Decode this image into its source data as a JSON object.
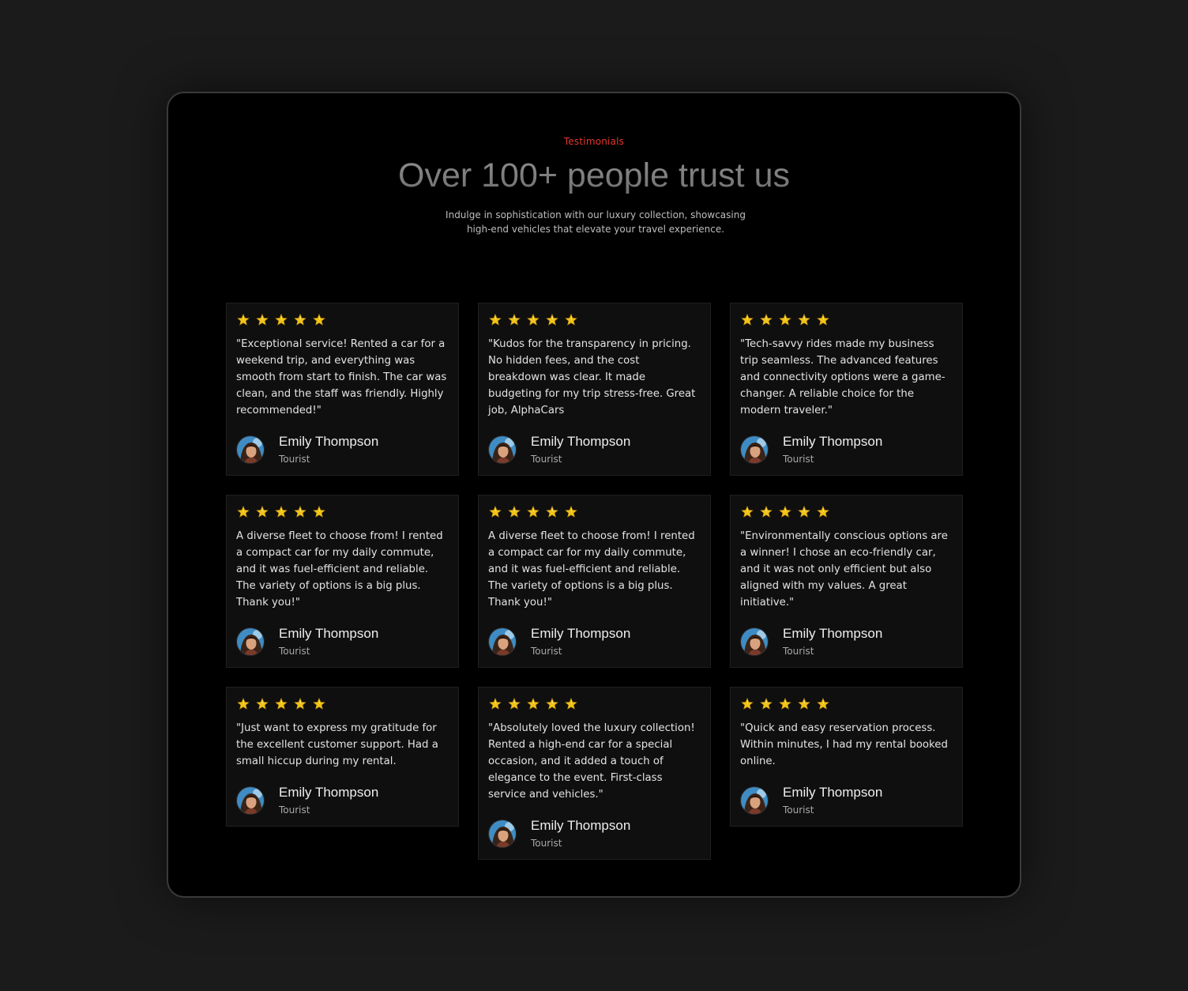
{
  "section": {
    "eyebrow": "Testimonials",
    "title": "Over 100+ people trust us",
    "subtitle": "Indulge in sophistication with our luxury collection, showcasing high-end vehicles that elevate your travel experience."
  },
  "colors": {
    "accent": "#e5372f",
    "star": "#f0c419",
    "card_bg": "#0f0f0f",
    "page_bg": "#1b1b1b"
  },
  "icons": {
    "rating": "star-icon",
    "avatar": "avatar-photo"
  },
  "columns": [
    {
      "cards": [
        {
          "rating": 5,
          "quote": "\"Exceptional service! Rented a car for a weekend trip, and everything was smooth from start to finish. The car was clean, and the staff was friendly. Highly recommended!\"",
          "name": "Emily Thompson",
          "role": "Tourist"
        },
        {
          "rating": 5,
          "quote": "A diverse fleet to choose from! I rented a compact car for my daily commute, and it was fuel-efficient and reliable. The variety of options is a big plus. Thank you!\"",
          "name": "Emily Thompson",
          "role": "Tourist"
        },
        {
          "rating": 5,
          "quote": "\"Just want to express my gratitude for the excellent customer support. Had a small hiccup during my rental.",
          "name": "Emily Thompson",
          "role": "Tourist"
        }
      ]
    },
    {
      "cards": [
        {
          "rating": 5,
          "quote": "\"Kudos for the transparency in pricing. No hidden fees, and the cost breakdown was clear. It made budgeting for my trip stress-free. Great job, AlphaCars",
          "name": "Emily Thompson",
          "role": "Tourist"
        },
        {
          "rating": 5,
          "quote": "A diverse fleet to choose from! I rented a compact car for my daily commute, and it was fuel-efficient and reliable. The variety of options is a big plus. Thank you!\"",
          "name": "Emily Thompson",
          "role": "Tourist"
        },
        {
          "rating": 5,
          "quote": "\"Absolutely loved the luxury collection! Rented a high-end car for a special occasion, and it added a touch of elegance to the event. First-class service and vehicles.\"",
          "name": "Emily Thompson",
          "role": "Tourist"
        }
      ]
    },
    {
      "cards": [
        {
          "rating": 5,
          "quote": "\"Tech-savvy rides made my business trip seamless. The advanced features and connectivity options were a game-changer. A reliable choice for the modern traveler.\"",
          "name": "Emily Thompson",
          "role": "Tourist"
        },
        {
          "rating": 5,
          "quote": "\"Environmentally conscious options are a winner! I chose an eco-friendly car, and it was not only efficient but also aligned with my values. A great initiative.\"",
          "name": "Emily Thompson",
          "role": "Tourist"
        },
        {
          "rating": 5,
          "quote": "\"Quick and easy reservation process. Within minutes, I had my rental booked online.",
          "name": "Emily Thompson",
          "role": "Tourist"
        }
      ]
    }
  ]
}
